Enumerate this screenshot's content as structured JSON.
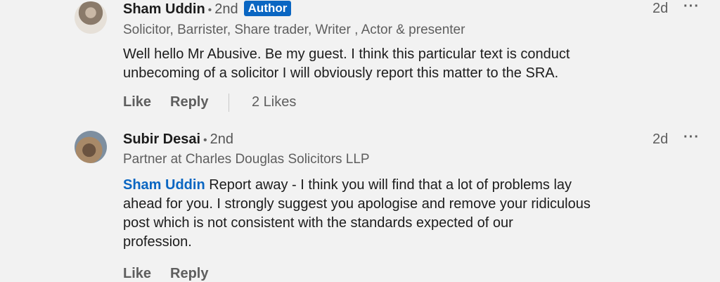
{
  "comments": [
    {
      "author": "Sham Uddin",
      "separator": "•",
      "degree": "2nd",
      "badge": "Author",
      "headline": "Solicitor, Barrister, Share trader, Writer , Actor & presenter",
      "text_line1": "Well hello Mr Abusive. Be my guest. I think this particular text is conduct",
      "text_line2": "unbecoming of a solicitor I will obviously report this matter to the SRA.",
      "time": "2d",
      "more": "···",
      "like_label": "Like",
      "reply_label": "Reply",
      "likes_count": "2 Likes"
    },
    {
      "author": "Subir Desai",
      "separator": "•",
      "degree": "2nd",
      "headline": "Partner at Charles Douglas Solicitors LLP",
      "mention": "Sham Uddin",
      "text_line1": " Report away - I think you will find that a lot of problems lay",
      "text_line2": "ahead for you. I strongly suggest you apologise and remove your ridiculous",
      "text_line3": "post which is not consistent with the standards expected of our",
      "text_line4": "profession.",
      "time": "2d",
      "more": "···",
      "like_label": "Like",
      "reply_label": "Reply"
    }
  ],
  "colors": {
    "link": "#0a66c2",
    "badge_bg": "#0a66c2",
    "background": "#f2f2f2"
  }
}
